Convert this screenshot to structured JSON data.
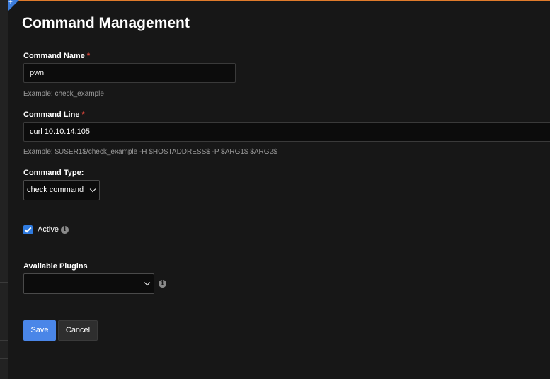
{
  "page": {
    "title": "Command Management"
  },
  "form": {
    "command_name": {
      "label": "Command Name",
      "required_mark": "*",
      "value": "pwn",
      "help": "Example: check_example"
    },
    "command_line": {
      "label": "Command Line",
      "required_mark": "*",
      "value": "curl 10.10.14.105",
      "help": "Example: $USER1$/check_example -H $HOSTADDRESS$ -P $ARG1$ $ARG2$"
    },
    "command_type": {
      "label": "Command Type:",
      "selected": "check command"
    },
    "active": {
      "label": "Active",
      "checked": true,
      "info_icon": "info-icon"
    },
    "available_plugins": {
      "label": "Available Plugins",
      "selected": "",
      "info_icon": "info-icon"
    }
  },
  "actions": {
    "save_label": "Save",
    "cancel_label": "Cancel"
  },
  "colors": {
    "accent": "#4a86e8",
    "top_bar": "#e07b2b",
    "required": "#e0463a",
    "background": "#171717"
  }
}
